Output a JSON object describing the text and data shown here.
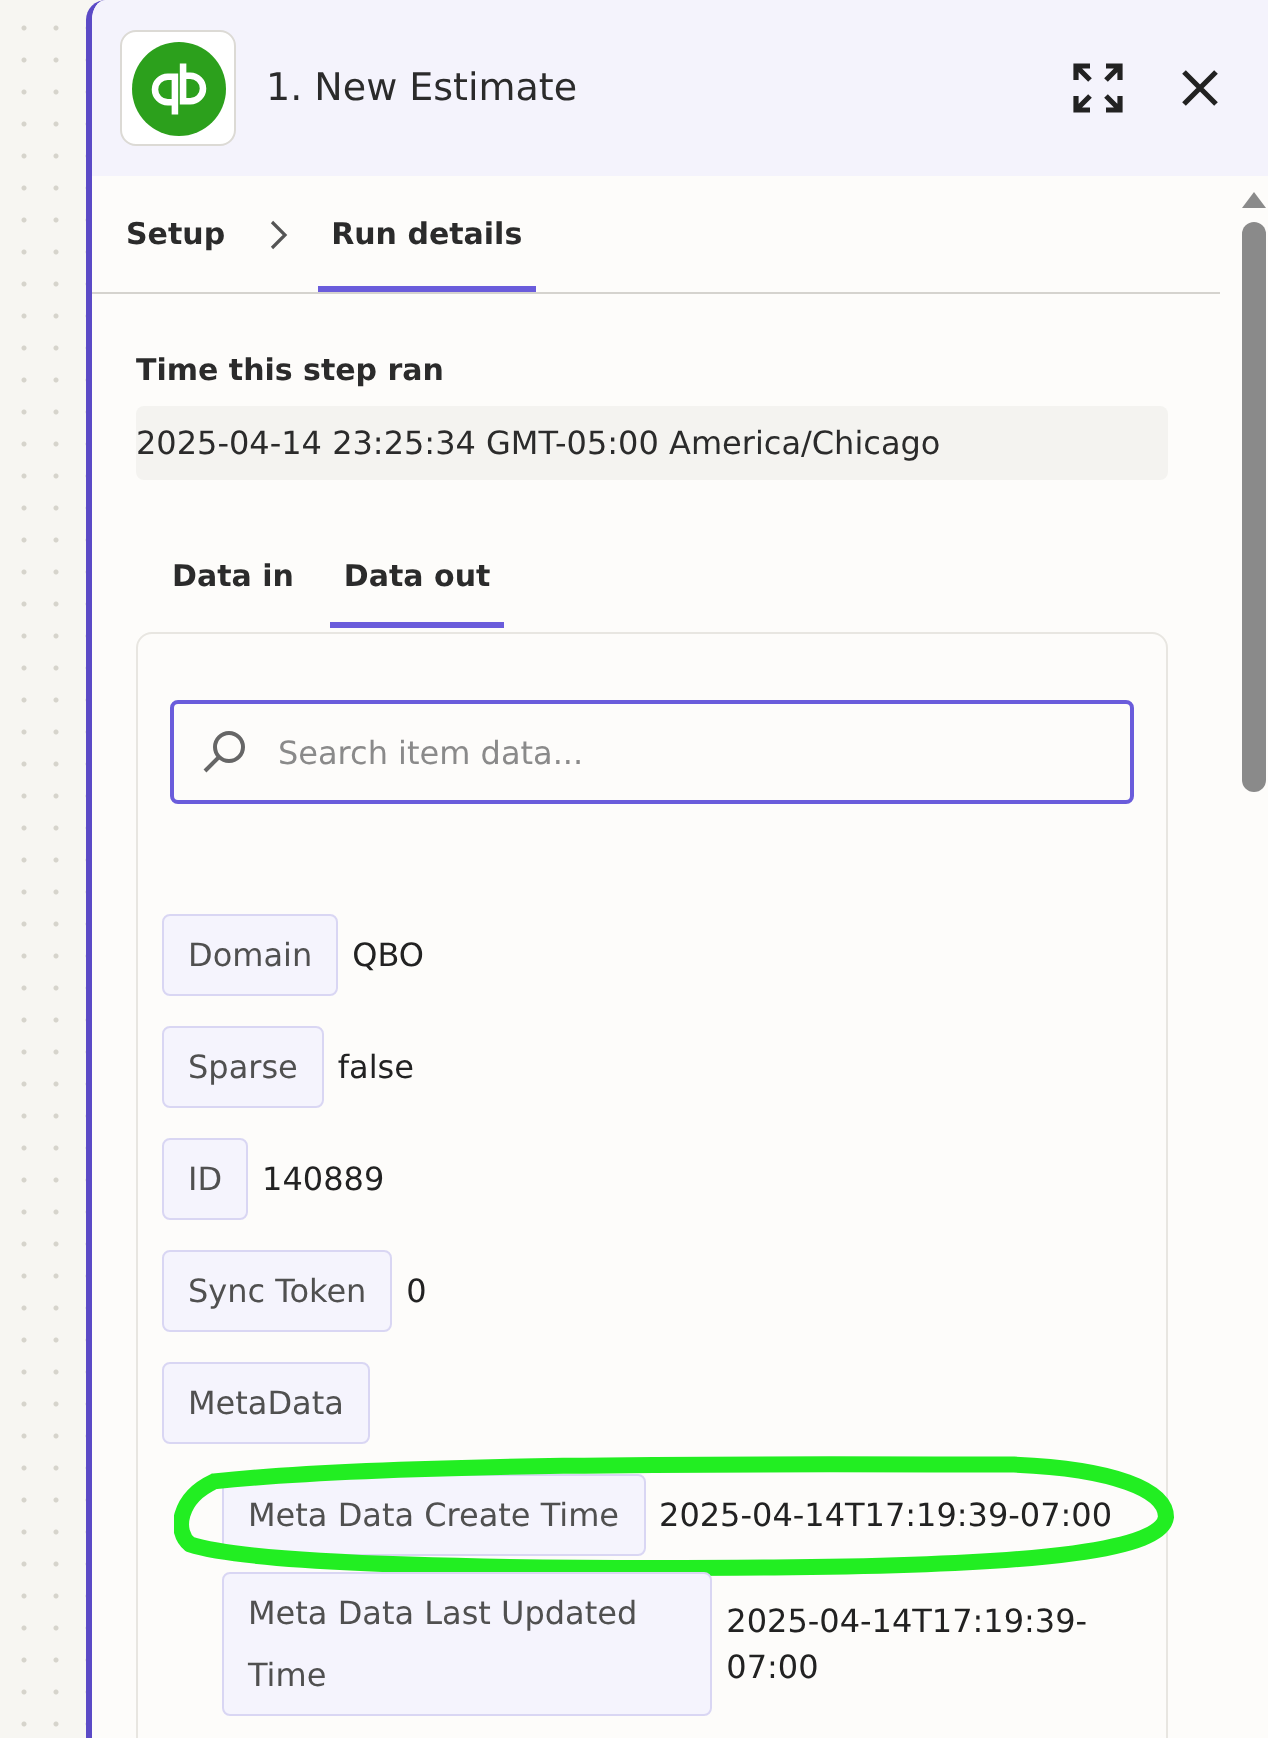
{
  "step": {
    "title": "1. New Estimate"
  },
  "tabs": [
    {
      "label": "Setup",
      "selected": false
    },
    {
      "label": "Run details",
      "selected": true
    }
  ],
  "run_time": {
    "label": "Time this step ran",
    "value": "2025-04-14 23:25:34 GMT-05:00 America/Chicago"
  },
  "data_tabs": [
    {
      "label": "Data in",
      "selected": false
    },
    {
      "label": "Data out",
      "selected": true
    }
  ],
  "search": {
    "placeholder": "Search item data...",
    "focused": true
  },
  "fields": [
    {
      "key": "Domain",
      "value": "QBO"
    },
    {
      "key": "Sparse",
      "value": "false"
    },
    {
      "key": "ID",
      "value": "140889"
    },
    {
      "key": "Sync Token",
      "value": "0"
    },
    {
      "key": "MetaData",
      "children": [
        {
          "key": "Meta Data Create Time",
          "value": "2025-04-14T17:19:39-07:00",
          "circled": true
        },
        {
          "key": "Meta Data Last Updated Time",
          "value": "2025-04-14T17:19:39-07:00",
          "circled": false
        }
      ]
    }
  ]
}
